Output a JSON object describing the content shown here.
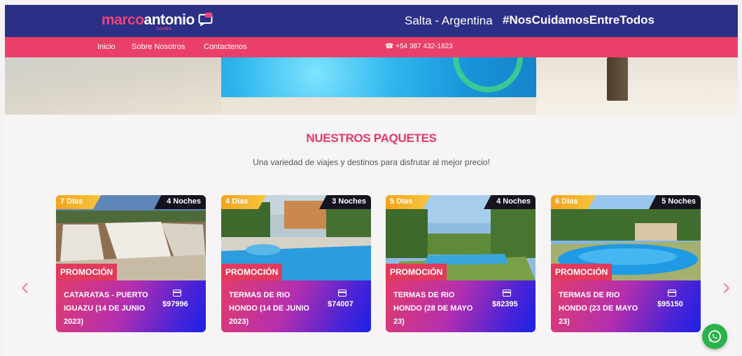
{
  "header": {
    "logo_brand": "marco",
    "logo_name": "antonio",
    "logo_sub": "TOURS",
    "location": "Salta - Argentina",
    "hashtag": "#NosCuidamosEntreTodos"
  },
  "nav": {
    "items": [
      {
        "label": "Inicio"
      },
      {
        "label": "Sobre Nosotros"
      },
      {
        "label": "Contactenos"
      }
    ],
    "phone": "☎ +54 387 432-1823"
  },
  "section": {
    "title": "NUESTROS PAQUETES",
    "subtitle": "Una variedad de viajes y destinos para disfrutar al mejor precio!"
  },
  "carousel": {
    "prev": "‹",
    "next": "›"
  },
  "packages": [
    {
      "days": "7 Días",
      "nights": "4 Noches",
      "promo": "PROMOCIÓN",
      "name": "CATARATAS - PUERTO IGUAZU (14 DE JUNIO 2023)",
      "price": "$97996",
      "photo": "waterfall"
    },
    {
      "days": "4 Días",
      "nights": "3 Noches",
      "promo": "PROMOCIÓN",
      "name": "TERMAS DE RIO HONDO (14 DE JUNIO 2023)",
      "price": "$74007",
      "photo": "hotel-pool"
    },
    {
      "days": "5 Días",
      "nights": "4 Noches",
      "promo": "PROMOCIÓN",
      "name": "TERMAS DE RIO HONDO (28 DE MAYO 23)",
      "price": "$82395",
      "photo": "garden-pool"
    },
    {
      "days": "6 Días",
      "nights": "5 Noches",
      "promo": "PROMOCIÓN",
      "name": "TERMAS DE RIO HONDO (23 DE MAYO 23)",
      "price": "$95150",
      "photo": "big-pool"
    }
  ],
  "colors": {
    "header_bg": "#2b2f86",
    "nav_bg": "#ea3f68",
    "accent": "#e23968",
    "whatsapp": "#2ab34a"
  },
  "icons": [
    "logo-chat-icon",
    "phone-icon",
    "credit-card-icon",
    "whatsapp-icon",
    "chevron-left-icon",
    "chevron-right-icon"
  ]
}
